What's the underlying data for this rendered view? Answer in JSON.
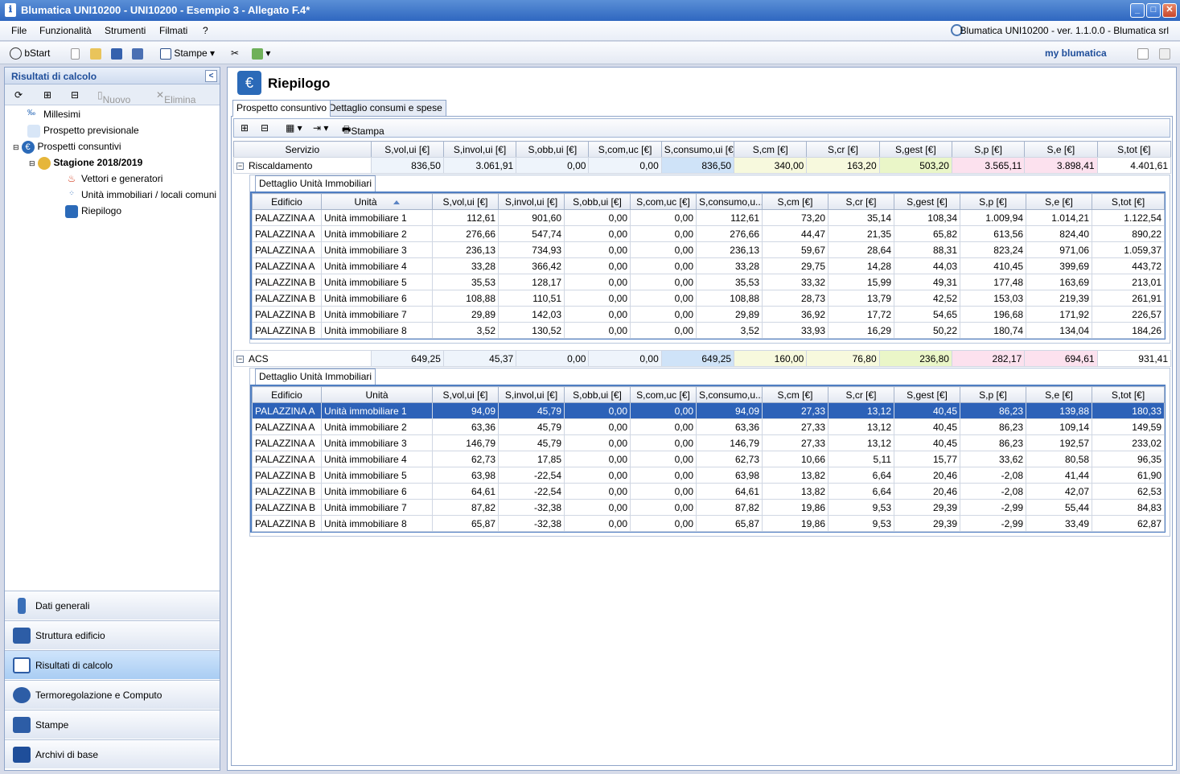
{
  "window": {
    "title": "Blumatica UNI10200 - UNI10200 - Esempio 3 - Allegato F.4*"
  },
  "menu": {
    "items": [
      "File",
      "Funzionalità",
      "Strumenti",
      "Filmati",
      "?"
    ],
    "version": "Blumatica UNI10200 - ver. 1.1.0.0 - Blumatica srl"
  },
  "toolbar": {
    "bstart": "bStart",
    "stampe": "Stampe",
    "brand": "my blumatica"
  },
  "left": {
    "header": "Risultati di calcolo",
    "tools": {
      "nuovo": "Nuovo",
      "elimina": "Elimina"
    },
    "tree": [
      "Millesimi",
      "Prospetto previsionale",
      "Prospetti consuntivi",
      "Stagione 2018/2019",
      "Vettori e generatori",
      "Unità immobiliari / locali comuni",
      "Riepilogo"
    ],
    "nav": [
      "Dati generali",
      "Struttura edificio",
      "Risultati di calcolo",
      "Termoregolazione e Computo",
      "Stampe",
      "Archivi di base"
    ]
  },
  "main": {
    "title": "Riepilogo",
    "tabs": [
      "Prospetto consuntivo",
      "Dettaglio consumi e spese"
    ],
    "stampa": "Stampa",
    "cols": [
      "Servizio",
      "S,vol,ui [€]",
      "S,invol,ui [€]",
      "S,obb,ui [€]",
      "S,com,uc [€]",
      "S,consumo,ui [€]",
      "S,cm [€]",
      "S,cr [€]",
      "S,gest [€]",
      "S,p [€]",
      "S,e [€]",
      "S,tot [€]"
    ],
    "detail_tab": "Dettaglio Unità Immobiliari",
    "detail_cols": [
      "Edificio",
      "Unità",
      "S,vol,ui [€]",
      "S,invol,ui [€]",
      "S,obb,ui [€]",
      "S,com,uc [€]",
      "S,consumo,u...",
      "S,cm [€]",
      "S,cr [€]",
      "S,gest [€]",
      "S,p [€]",
      "S,e [€]",
      "S,tot [€]"
    ],
    "groups": [
      {
        "name": "Riscaldamento",
        "values": [
          "836,50",
          "3.061,91",
          "0,00",
          "0,00",
          "836,50",
          "340,00",
          "163,20",
          "503,20",
          "3.565,11",
          "3.898,41",
          "4.401,61"
        ],
        "rows": [
          [
            "PALAZZINA A",
            "Unità immobiliare 1",
            "112,61",
            "901,60",
            "0,00",
            "0,00",
            "112,61",
            "73,20",
            "35,14",
            "108,34",
            "1.009,94",
            "1.014,21",
            "1.122,54"
          ],
          [
            "PALAZZINA A",
            "Unità immobiliare 2",
            "276,66",
            "547,74",
            "0,00",
            "0,00",
            "276,66",
            "44,47",
            "21,35",
            "65,82",
            "613,56",
            "824,40",
            "890,22"
          ],
          [
            "PALAZZINA A",
            "Unità immobiliare 3",
            "236,13",
            "734,93",
            "0,00",
            "0,00",
            "236,13",
            "59,67",
            "28,64",
            "88,31",
            "823,24",
            "971,06",
            "1.059,37"
          ],
          [
            "PALAZZINA A",
            "Unità immobiliare 4",
            "33,28",
            "366,42",
            "0,00",
            "0,00",
            "33,28",
            "29,75",
            "14,28",
            "44,03",
            "410,45",
            "399,69",
            "443,72"
          ],
          [
            "PALAZZINA B",
            "Unità immobiliare 5",
            "35,53",
            "128,17",
            "0,00",
            "0,00",
            "35,53",
            "33,32",
            "15,99",
            "49,31",
            "177,48",
            "163,69",
            "213,01"
          ],
          [
            "PALAZZINA B",
            "Unità immobiliare 6",
            "108,88",
            "110,51",
            "0,00",
            "0,00",
            "108,88",
            "28,73",
            "13,79",
            "42,52",
            "153,03",
            "219,39",
            "261,91"
          ],
          [
            "PALAZZINA B",
            "Unità immobiliare 7",
            "29,89",
            "142,03",
            "0,00",
            "0,00",
            "29,89",
            "36,92",
            "17,72",
            "54,65",
            "196,68",
            "171,92",
            "226,57"
          ],
          [
            "PALAZZINA B",
            "Unità immobiliare 8",
            "3,52",
            "130,52",
            "0,00",
            "0,00",
            "3,52",
            "33,93",
            "16,29",
            "50,22",
            "180,74",
            "134,04",
            "184,26"
          ]
        ]
      },
      {
        "name": "ACS",
        "values": [
          "649,25",
          "45,37",
          "0,00",
          "0,00",
          "649,25",
          "160,00",
          "76,80",
          "236,80",
          "282,17",
          "694,61",
          "931,41"
        ],
        "rows": [
          [
            "PALAZZINA A",
            "Unità immobiliare 1",
            "94,09",
            "45,79",
            "0,00",
            "0,00",
            "94,09",
            "27,33",
            "13,12",
            "40,45",
            "86,23",
            "139,88",
            "180,33"
          ],
          [
            "PALAZZINA A",
            "Unità immobiliare 2",
            "63,36",
            "45,79",
            "0,00",
            "0,00",
            "63,36",
            "27,33",
            "13,12",
            "40,45",
            "86,23",
            "109,14",
            "149,59"
          ],
          [
            "PALAZZINA A",
            "Unità immobiliare 3",
            "146,79",
            "45,79",
            "0,00",
            "0,00",
            "146,79",
            "27,33",
            "13,12",
            "40,45",
            "86,23",
            "192,57",
            "233,02"
          ],
          [
            "PALAZZINA A",
            "Unità immobiliare 4",
            "62,73",
            "17,85",
            "0,00",
            "0,00",
            "62,73",
            "10,66",
            "5,11",
            "15,77",
            "33,62",
            "80,58",
            "96,35"
          ],
          [
            "PALAZZINA B",
            "Unità immobiliare 5",
            "63,98",
            "-22,54",
            "0,00",
            "0,00",
            "63,98",
            "13,82",
            "6,64",
            "20,46",
            "-2,08",
            "41,44",
            "61,90"
          ],
          [
            "PALAZZINA B",
            "Unità immobiliare 6",
            "64,61",
            "-22,54",
            "0,00",
            "0,00",
            "64,61",
            "13,82",
            "6,64",
            "20,46",
            "-2,08",
            "42,07",
            "62,53"
          ],
          [
            "PALAZZINA B",
            "Unità immobiliare 7",
            "87,82",
            "-32,38",
            "0,00",
            "0,00",
            "87,82",
            "19,86",
            "9,53",
            "29,39",
            "-2,99",
            "55,44",
            "84,83"
          ],
          [
            "PALAZZINA B",
            "Unità immobiliare 8",
            "65,87",
            "-32,38",
            "0,00",
            "0,00",
            "65,87",
            "19,86",
            "9,53",
            "29,39",
            "-2,99",
            "33,49",
            "62,87"
          ]
        ]
      }
    ]
  },
  "colors": {
    "selection": "#2d62b8",
    "accent": "#2f67c0"
  }
}
